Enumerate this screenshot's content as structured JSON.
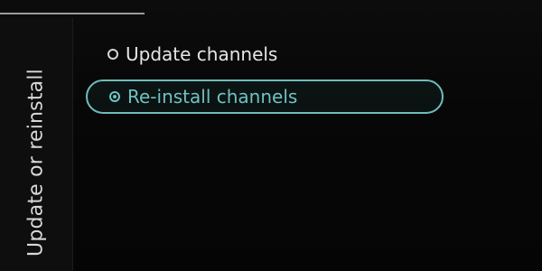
{
  "side_panel": {
    "title": "Update or reinstall"
  },
  "options": [
    {
      "label": "Update channels",
      "selected": false
    },
    {
      "label": "Re-install channels",
      "selected": true
    }
  ],
  "colors": {
    "accent": "#6fc2c2",
    "text": "#e6e6e6",
    "background": "#070707"
  }
}
